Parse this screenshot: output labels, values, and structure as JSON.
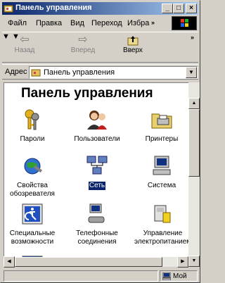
{
  "window": {
    "title": "Панель управления"
  },
  "menu": {
    "items": [
      {
        "label": "Файл"
      },
      {
        "label": "Правка"
      },
      {
        "label": "Вид"
      },
      {
        "label": "Переход"
      },
      {
        "label": "Избра"
      }
    ],
    "overflow": "»"
  },
  "toolbar": {
    "back_label": "Назад",
    "forward_label": "Вперед",
    "up_label": "Вверх",
    "overflow": "»"
  },
  "address": {
    "label": "Адрес",
    "value": "Панель управления"
  },
  "content": {
    "heading": "Панель управления",
    "items": [
      {
        "label": "Пароли",
        "icon": "keys-icon"
      },
      {
        "label": "Пользователи",
        "icon": "users-icon"
      },
      {
        "label": "Принтеры",
        "icon": "printer-folder-icon"
      },
      {
        "label": "Свойства обозревателя",
        "icon": "internet-options-icon"
      },
      {
        "label": "Сеть",
        "icon": "network-icon",
        "selected": true
      },
      {
        "label": "Система",
        "icon": "computer-icon"
      },
      {
        "label": "Специальные возможности",
        "icon": "accessibility-icon"
      },
      {
        "label": "Телефонные соединения",
        "icon": "dialup-icon"
      },
      {
        "label": "Управление электропитанием",
        "icon": "power-icon"
      }
    ]
  },
  "status": {
    "zone": "Мой"
  },
  "colors": {
    "titlebar_start": "#0a246a",
    "titlebar_end": "#a6caf0",
    "selection": "#0a246a",
    "face": "#d4d0c8"
  }
}
